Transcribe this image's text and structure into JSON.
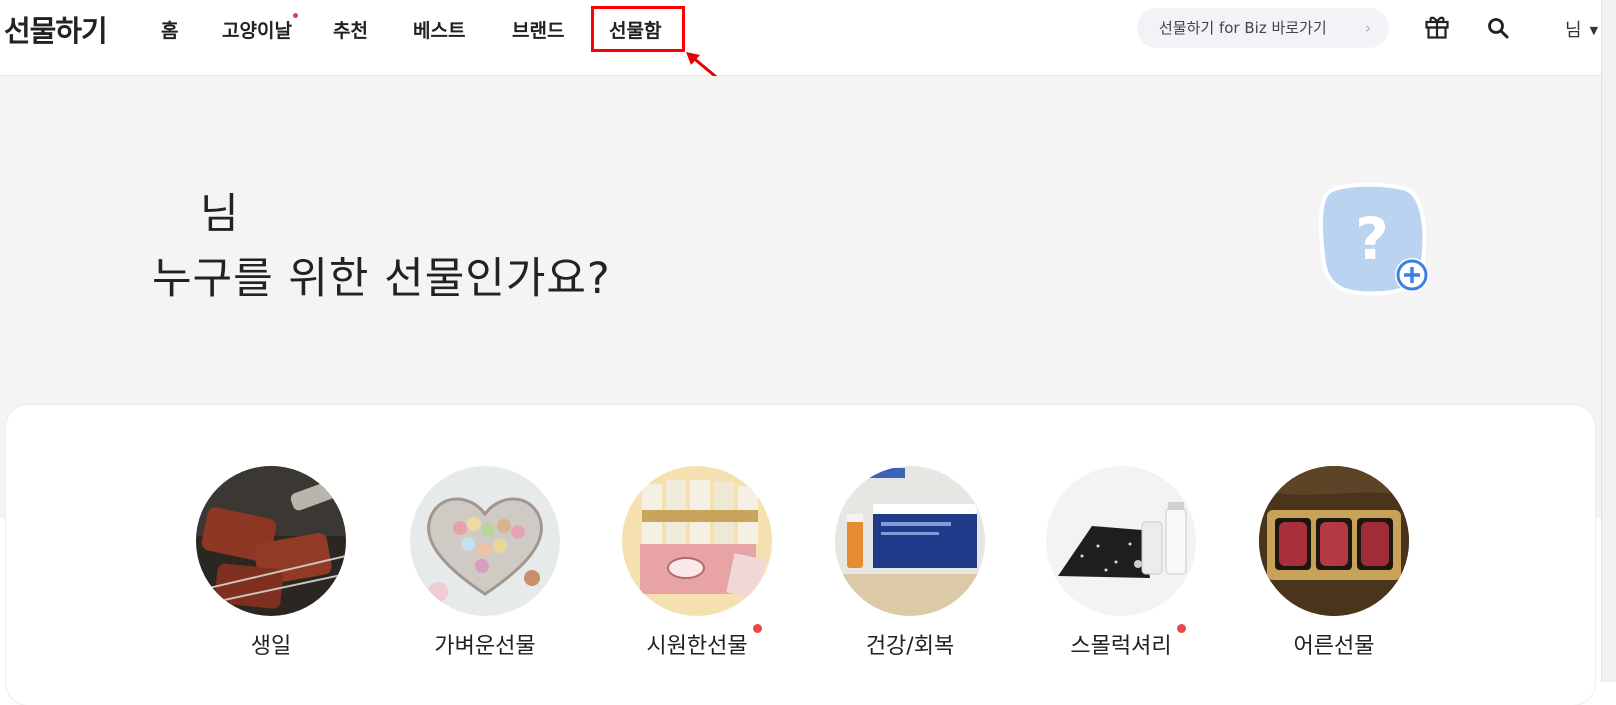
{
  "header": {
    "logo": "선물하기",
    "nav": [
      {
        "label": "홈"
      },
      {
        "label": "고양이날"
      },
      {
        "label": "추천"
      },
      {
        "label": "베스트"
      },
      {
        "label": "브랜드"
      },
      {
        "label": "선물함"
      }
    ],
    "biz_link": "선물하기 for Biz 바로가기",
    "user": "님",
    "icons": [
      "gift-icon",
      "search-icon",
      "caret-down-icon"
    ]
  },
  "hero": {
    "user_name": "님",
    "question": "누구를 위한 선물인가요?",
    "profile_placeholder": "?"
  },
  "categories": [
    {
      "label": "생일",
      "has_dot": false
    },
    {
      "label": "가벼운선물",
      "has_dot": false
    },
    {
      "label": "시원한선물",
      "has_dot": true
    },
    {
      "label": "건강/회복",
      "has_dot": false
    },
    {
      "label": "스몰럭셔리",
      "has_dot": true
    },
    {
      "label": "어른선물",
      "has_dot": false
    }
  ],
  "colors": {
    "accent_yellow": "#ffe100",
    "new_dot": "#f04545",
    "annotation_red": "#ff0000",
    "profile_blue": "#b9d3f1",
    "plus_blue": "#3f7fe3"
  }
}
